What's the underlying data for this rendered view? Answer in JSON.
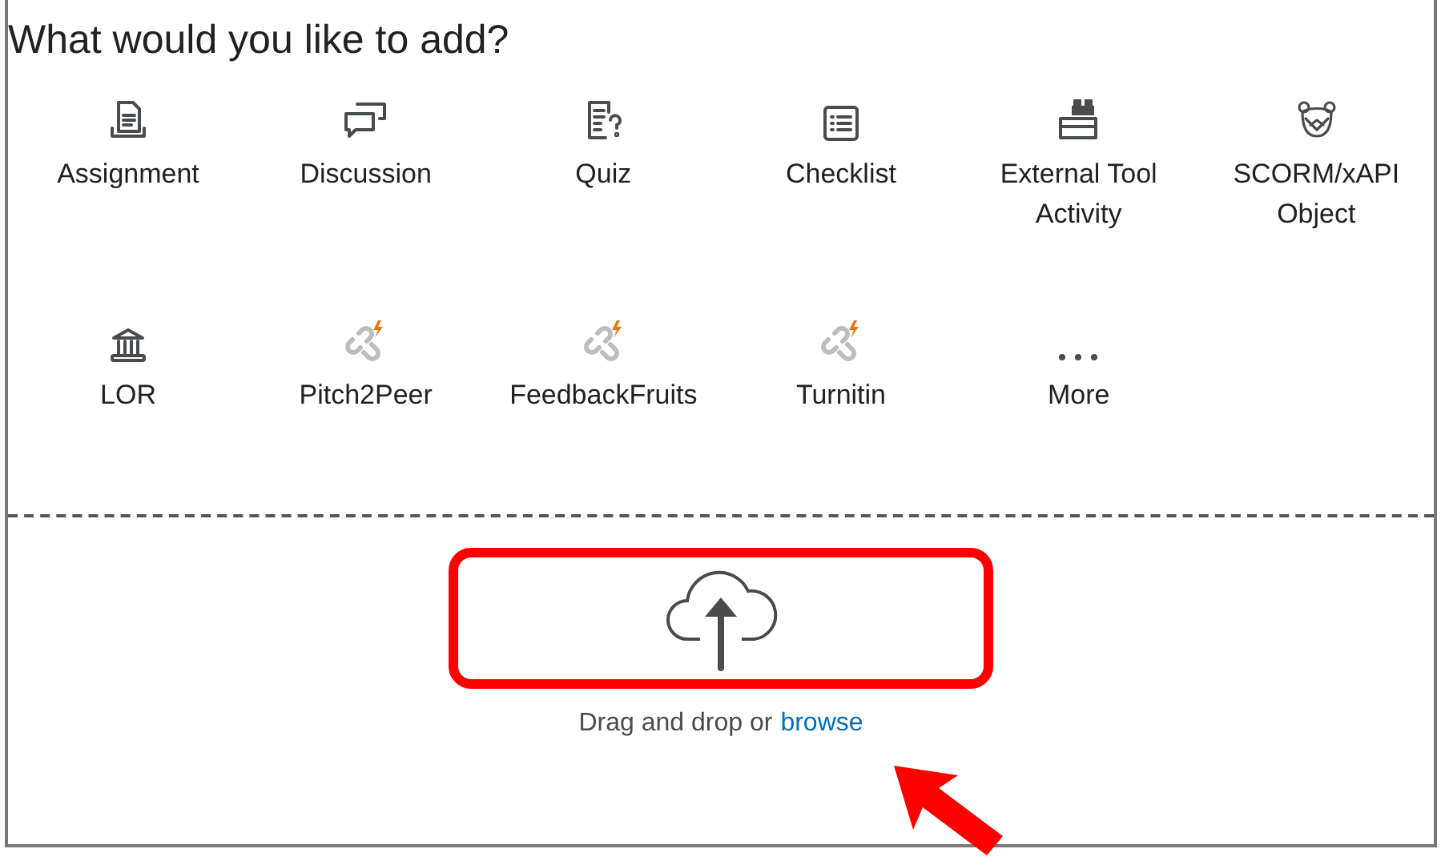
{
  "title": "What would you like to add?",
  "items": [
    {
      "kind": "assignment",
      "label": "Assignment"
    },
    {
      "kind": "discussion",
      "label": "Discussion"
    },
    {
      "kind": "quiz",
      "label": "Quiz"
    },
    {
      "kind": "checklist",
      "label": "Checklist"
    },
    {
      "kind": "lti",
      "label": "External Tool Activity"
    },
    {
      "kind": "scorm",
      "label": "SCORM/xAPI Object"
    },
    {
      "kind": "lor",
      "label": "LOR"
    },
    {
      "kind": "integration",
      "label": "Pitch2Peer"
    },
    {
      "kind": "integration",
      "label": "FeedbackFruits"
    },
    {
      "kind": "integration",
      "label": "Turnitin"
    },
    {
      "kind": "more",
      "label": "More"
    }
  ],
  "upload": {
    "text": "Drag and drop or",
    "link": "browse"
  }
}
